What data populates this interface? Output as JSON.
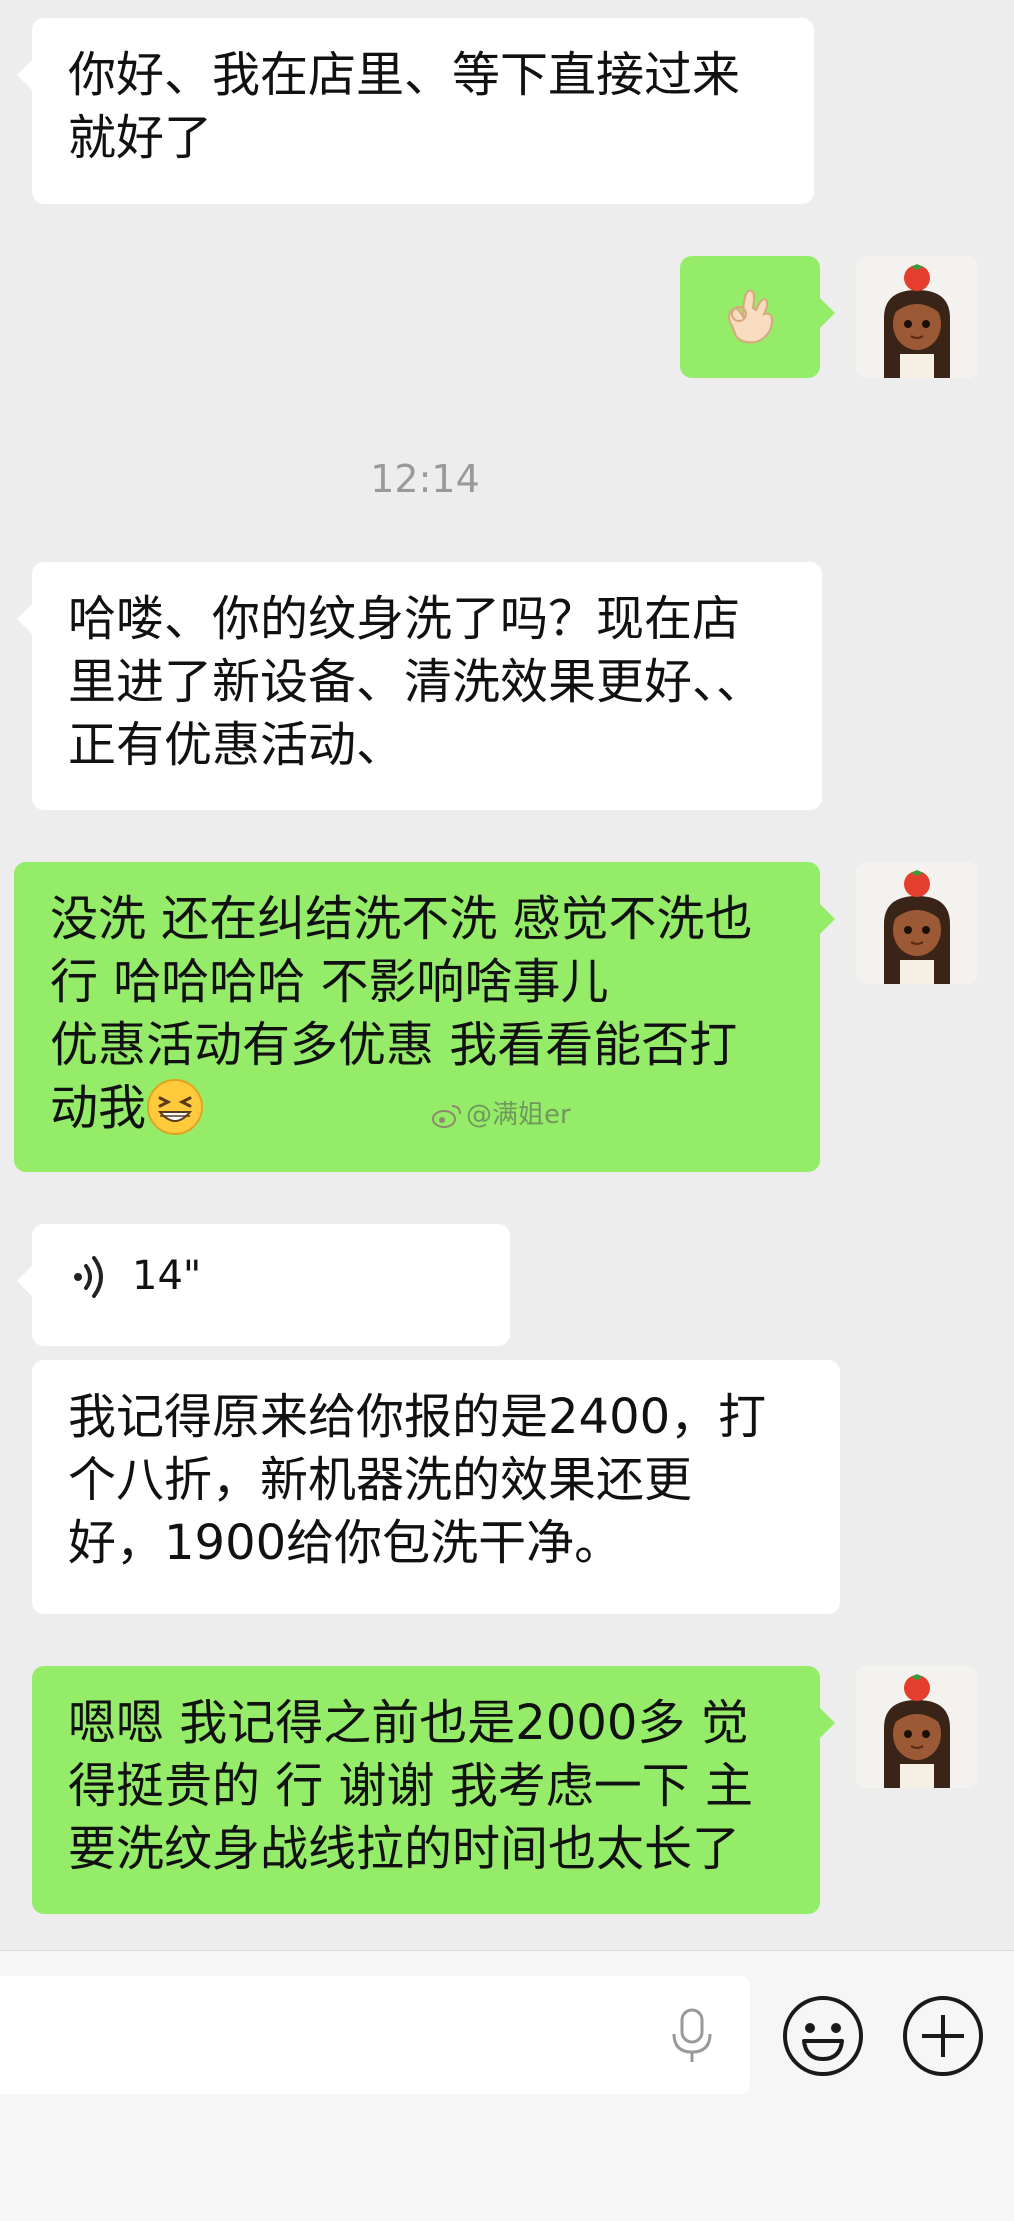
{
  "messages": [
    {
      "side": "incoming",
      "lines": [
        "你好、我在店里、等下直接过来",
        "就好了"
      ]
    },
    {
      "side": "outgoing",
      "emoji": "ok-hand"
    },
    {
      "timestamp": "12:14"
    },
    {
      "side": "incoming",
      "lines": [
        "哈喽、你的纹身洗了吗？现在店",
        "里进了新设备、清洗效果更好、、",
        "正有优惠活动、"
      ]
    },
    {
      "side": "outgoing",
      "lines": [
        "没洗 还在纠结洗不洗 感觉不洗也",
        "行 哈哈哈哈 不影响啥事儿",
        "优惠活动有多优惠 我看看能否打",
        "动我"
      ],
      "trailing_emoji": "grinning-squint-face"
    },
    {
      "side": "incoming",
      "type": "voice",
      "duration": "14\""
    },
    {
      "side": "incoming",
      "lines": [
        "我记得原来给你报的是2400，打",
        "个八折，新机器洗的效果还更",
        "好，1900给你包洗干净。"
      ]
    },
    {
      "side": "outgoing",
      "lines": [
        "嗯嗯 我记得之前也是2000多 觉",
        "得挺贵的 行 谢谢 我考虑一下 主",
        "要洗纹身战线拉的时间也太长了"
      ]
    }
  ],
  "watermark": "@满姐er",
  "input_bar": {
    "icons": [
      "microphone-icon",
      "emoji-icon",
      "plus-icon"
    ]
  },
  "colors": {
    "background": "#ededed",
    "incoming_bubble": "#ffffff",
    "outgoing_bubble": "#95ec69",
    "timestamp_text": "#9a9a9a"
  }
}
